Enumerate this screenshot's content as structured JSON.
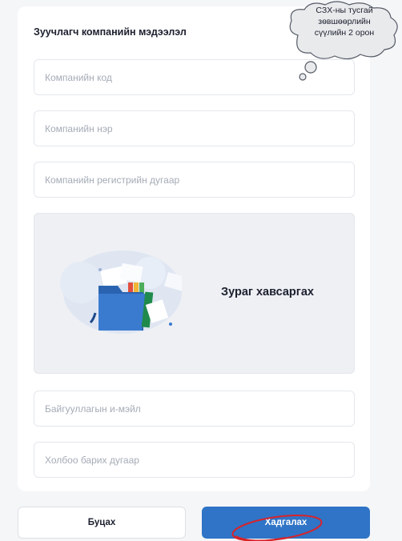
{
  "form": {
    "title": "Зуучлагч компанийн мэдээлэл",
    "company_code_placeholder": "Компанийн код",
    "company_name_placeholder": "Компанийн нэр",
    "company_reg_placeholder": "Компанийн регистрийн дугаар",
    "upload_label": "Зураг хавсаргах",
    "email_placeholder": "Байгууллагын и-мэйл",
    "phone_placeholder": "Холбоо барих дугаар"
  },
  "buttons": {
    "back": "Буцах",
    "save": "Хадгалах"
  },
  "annotation": {
    "line1": "СЗХ-ны тусгай",
    "line2": "зөвшөөрлийн",
    "line3": "сүүлийн 2 орон"
  },
  "colors": {
    "primary": "#2f74c6",
    "annotation_circle": "#d8232a"
  }
}
